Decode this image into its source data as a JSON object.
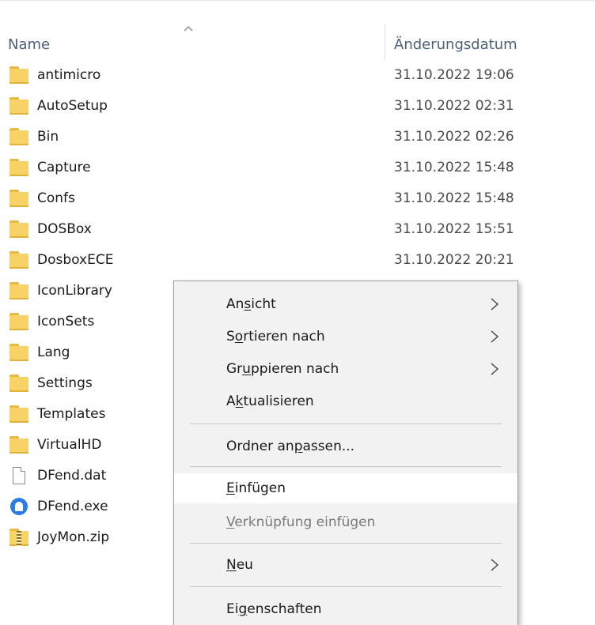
{
  "header": {
    "name_col": "Name",
    "date_col": "Änderungsdatum",
    "sort_icon": "sort-ascending-caret-icon"
  },
  "files": [
    {
      "name": "antimicro",
      "date": "31.10.2022 19:06",
      "icon": "folder-icon"
    },
    {
      "name": "AutoSetup",
      "date": "31.10.2022 02:31",
      "icon": "folder-icon"
    },
    {
      "name": "Bin",
      "date": "31.10.2022 02:26",
      "icon": "folder-icon"
    },
    {
      "name": "Capture",
      "date": "31.10.2022 15:48",
      "icon": "folder-icon"
    },
    {
      "name": "Confs",
      "date": "31.10.2022 15:48",
      "icon": "folder-icon"
    },
    {
      "name": "DOSBox",
      "date": "31.10.2022 15:51",
      "icon": "folder-icon"
    },
    {
      "name": "DosboxECE",
      "date": "31.10.2022 20:21",
      "icon": "folder-icon"
    },
    {
      "name": "IconLibrary",
      "date": "",
      "icon": "folder-icon"
    },
    {
      "name": "IconSets",
      "date": "",
      "icon": "folder-icon"
    },
    {
      "name": "Lang",
      "date": "",
      "icon": "folder-icon"
    },
    {
      "name": "Settings",
      "date": "",
      "icon": "folder-icon"
    },
    {
      "name": "Templates",
      "date": "",
      "icon": "folder-icon"
    },
    {
      "name": "VirtualHD",
      "date": "",
      "icon": "folder-icon"
    },
    {
      "name": "DFend.dat",
      "date": "",
      "icon": "file-icon"
    },
    {
      "name": "DFend.exe",
      "date": "",
      "icon": "exe-icon"
    },
    {
      "name": "JoyMon.zip",
      "date": "",
      "icon": "zip-icon"
    }
  ],
  "context_menu": {
    "items": [
      {
        "pre": "An",
        "mn": "s",
        "post": "icht",
        "submenu": true,
        "disabled": false
      },
      {
        "pre": "S",
        "mn": "o",
        "post": "rtieren nach",
        "submenu": true,
        "disabled": false
      },
      {
        "pre": "Gr",
        "mn": "u",
        "post": "ppieren nach",
        "submenu": true,
        "disabled": false
      },
      {
        "pre": "A",
        "mn": "k",
        "post": "tualisieren",
        "submenu": false,
        "disabled": false
      },
      {
        "pre": "Ordner an",
        "mn": "p",
        "post": "assen...",
        "submenu": false,
        "disabled": false
      },
      {
        "pre": "",
        "mn": "E",
        "post": "infügen",
        "submenu": false,
        "disabled": false,
        "hover": true
      },
      {
        "pre": "",
        "mn": "V",
        "post": "erknüpfung einfügen",
        "submenu": false,
        "disabled": true
      },
      {
        "pre": "",
        "mn": "N",
        "post": "eu",
        "submenu": true,
        "disabled": false
      },
      {
        "pre": "Ei",
        "mn": "g",
        "post": "enschaften",
        "submenu": false,
        "disabled": false
      }
    ],
    "arrow_icon": "chevron-right-icon"
  }
}
